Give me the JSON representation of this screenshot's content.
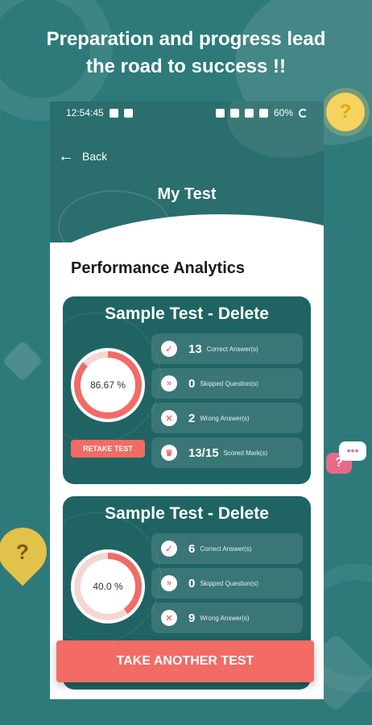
{
  "headline": {
    "line1": "Preparation and progress lead",
    "line2": "the road to success !!"
  },
  "status_bar": {
    "time": "12:54:45",
    "battery": "60%"
  },
  "header": {
    "back_label": "Back",
    "title": "My Test"
  },
  "section_title": "Performance Analytics",
  "cards": [
    {
      "title": "Sample Test - Delete",
      "percent_label": "86.67 %",
      "percent_value": 86.67,
      "retake_label": "RETAKE TEST",
      "stats": [
        {
          "value": "13",
          "label": "Correct Answer(s)",
          "icon": "check-icon"
        },
        {
          "value": "0",
          "label": "Skipped Question(s)",
          "icon": "skip-icon"
        },
        {
          "value": "2",
          "label": "Wrong Answer(s)",
          "icon": "close-icon"
        },
        {
          "value": "13/15",
          "label": "Scored Mark(s)",
          "icon": "trophy-icon"
        }
      ]
    },
    {
      "title": "Sample Test - Delete",
      "percent_label": "40.0 %",
      "percent_value": 40.0,
      "stats": [
        {
          "value": "6",
          "label": "Correct Answer(s)",
          "icon": "check-icon"
        },
        {
          "value": "0",
          "label": "Skipped Question(s)",
          "icon": "skip-icon"
        },
        {
          "value": "9",
          "label": "Wrong Answer(s)",
          "icon": "close-icon"
        }
      ]
    }
  ],
  "cta_label": "TAKE ANOTHER TEST",
  "colors": {
    "background": "#2e7a7a",
    "card": "#1f6463",
    "accent": "#f26b65"
  }
}
